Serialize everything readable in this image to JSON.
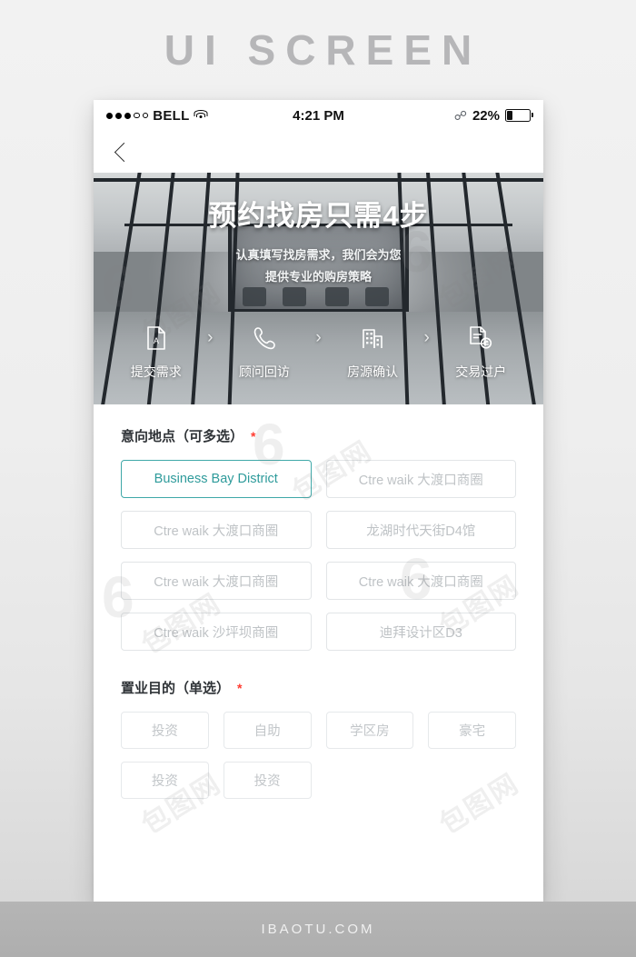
{
  "page": {
    "heading": "UI SCREEN",
    "footer_text": "IBAOTU.COM",
    "accent_color": "#3fa8a8",
    "required_color": "#ff3b30"
  },
  "statusbar": {
    "carrier": "BELL",
    "time": "4:21 PM",
    "battery_percent": "22%",
    "wifi_icon": "wifi-icon",
    "bluetooth_icon": "bluetooth-icon",
    "battery_icon": "battery-icon"
  },
  "navbar": {
    "back_icon": "chevron-left-icon"
  },
  "hero": {
    "title": "预约找房只需4步",
    "subtitle_line1": "认真填写找房需求，我们会为您",
    "subtitle_line2": "提供专业的购房策略",
    "arrow": "›",
    "steps": [
      {
        "label": "提交需求",
        "icon": "document-icon"
      },
      {
        "label": "顾问回访",
        "icon": "phone-icon"
      },
      {
        "label": "房源确认",
        "icon": "building-icon"
      },
      {
        "label": "交易过户",
        "icon": "transfer-document-icon"
      }
    ]
  },
  "form": {
    "location_section": {
      "label": "意向地点（可多选）",
      "required_mark": "*",
      "options": [
        {
          "label": "Business Bay District",
          "selected": true
        },
        {
          "label": "Ctre waik 大渡口商圈",
          "selected": false
        },
        {
          "label": "Ctre waik 大渡口商圈",
          "selected": false
        },
        {
          "label": "龙湖时代天街D4馆",
          "selected": false
        },
        {
          "label": "Ctre waik 大渡口商圈",
          "selected": false
        },
        {
          "label": "Ctre waik 大渡口商圈",
          "selected": false
        },
        {
          "label": "Ctre waik 沙坪坝商圈",
          "selected": false
        },
        {
          "label": "迪拜设计区D3",
          "selected": false
        }
      ]
    },
    "purpose_section": {
      "label": "置业目的（单选）",
      "required_mark": "*",
      "options": [
        {
          "label": "投资",
          "selected": false
        },
        {
          "label": "自助",
          "selected": false
        },
        {
          "label": "学区房",
          "selected": false
        },
        {
          "label": "豪宅",
          "selected": false
        },
        {
          "label": "投资",
          "selected": false
        },
        {
          "label": "投资",
          "selected": false
        }
      ]
    }
  }
}
